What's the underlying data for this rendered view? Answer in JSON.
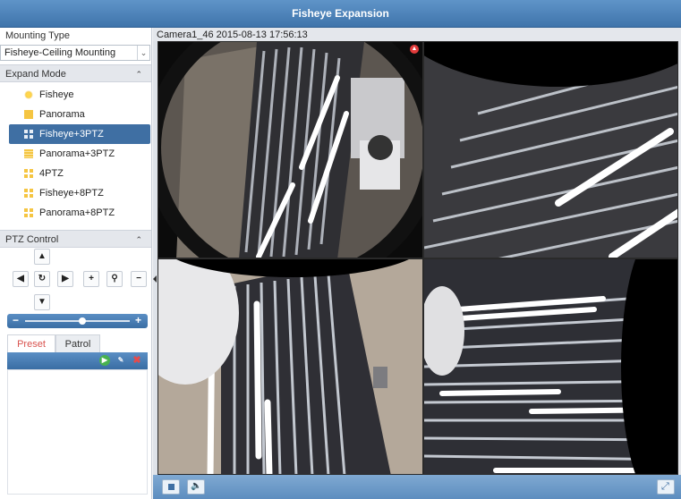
{
  "window": {
    "title": "Fisheye Expansion"
  },
  "mounting": {
    "label": "Mounting Type",
    "selected": "Fisheye-Ceiling Mounting"
  },
  "expand_mode": {
    "label": "Expand Mode",
    "items": [
      {
        "label": "Fisheye",
        "icon": "fisheye-icon"
      },
      {
        "label": "Panorama",
        "icon": "panorama-icon"
      },
      {
        "label": "Fisheye+3PTZ",
        "icon": "fisheye-3ptz-icon",
        "selected": true
      },
      {
        "label": "Panorama+3PTZ",
        "icon": "panorama-3ptz-icon"
      },
      {
        "label": "4PTZ",
        "icon": "4ptz-icon"
      },
      {
        "label": "Fisheye+8PTZ",
        "icon": "fisheye-8ptz-icon"
      },
      {
        "label": "Panorama+8PTZ",
        "icon": "panorama-8ptz-icon"
      }
    ]
  },
  "ptz": {
    "label": "PTZ Control",
    "zoom_minus": "−",
    "zoom_plus": "+"
  },
  "preset_tabs": {
    "preset": "Preset",
    "patrol": "Patrol"
  },
  "video": {
    "camera_label": "Camera1_46  2015-08-13 17:56:13"
  },
  "colors": {
    "accent": "#3f6fa3",
    "title_bar": "#4a7fb5",
    "preset_tab": "#d9534f"
  }
}
